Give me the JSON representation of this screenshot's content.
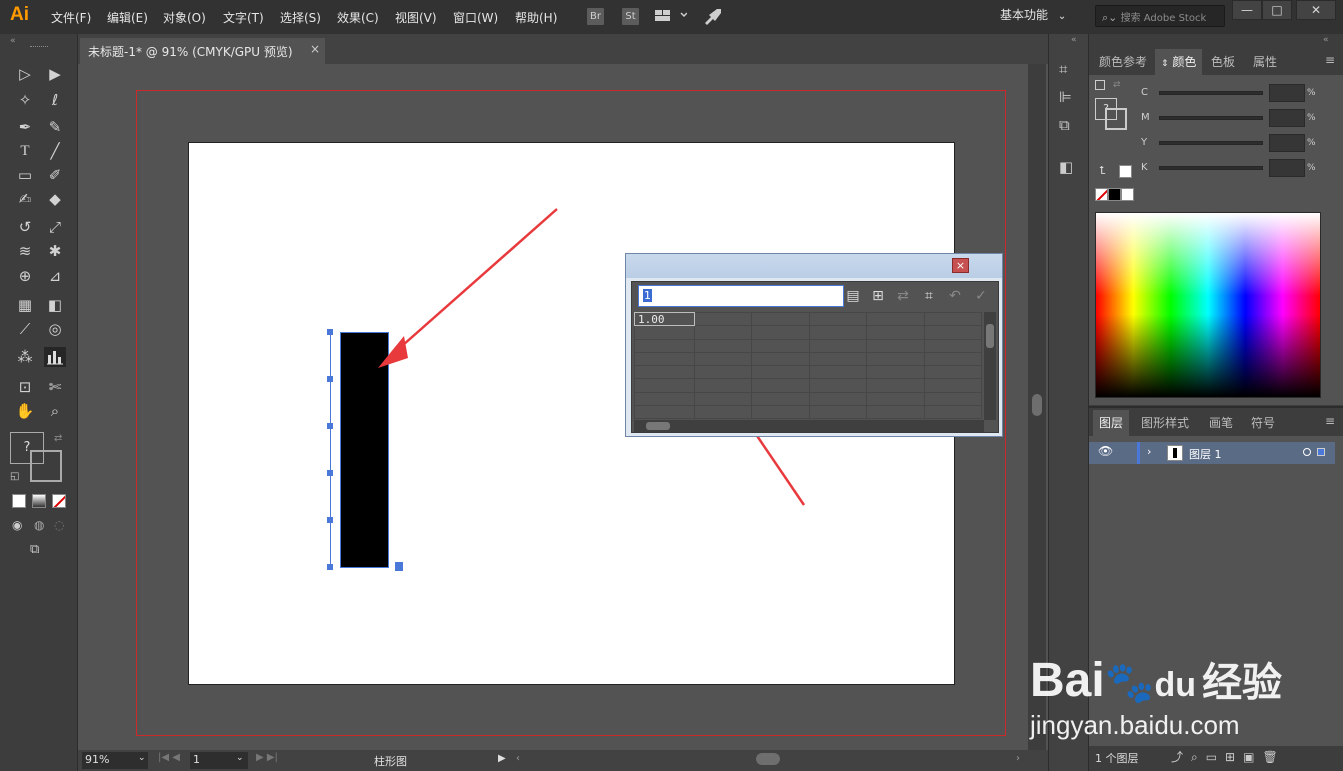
{
  "app": {
    "logo": "Ai"
  },
  "menu": [
    "文件(F)",
    "编辑(E)",
    "对象(O)",
    "文字(T)",
    "选择(S)",
    "效果(C)",
    "视图(V)",
    "窗口(W)",
    "帮助(H)"
  ],
  "menu_tools": {
    "br": "Br",
    "st": "St"
  },
  "workspace": {
    "label": "基本功能"
  },
  "search": {
    "placeholder": "搜索 Adobe Stock"
  },
  "window_controls": {
    "minimize": "—",
    "maximize": "□",
    "close": "✕"
  },
  "document_tab": {
    "title": "未标题-1* @ 91% (CMYK/GPU 预览)",
    "close": "×"
  },
  "graph_data_dialog": {
    "input_value": "1",
    "close": "×",
    "cells": [
      [
        "1.00",
        "",
        "",
        "",
        "",
        ""
      ]
    ]
  },
  "chart_data": {
    "type": "bar",
    "categories": [
      ""
    ],
    "values": [
      1.0
    ]
  },
  "toolbar_extras": {
    "unknown_fill": "?"
  },
  "color_panel": {
    "tabs": [
      "颜色参考",
      "颜色",
      "色板",
      "属性"
    ],
    "active_tab": "颜色",
    "channels": [
      "C",
      "M",
      "Y",
      "K"
    ],
    "percent": "%",
    "swatch_unknown": "?"
  },
  "layers_panel": {
    "tabs": [
      "图层",
      "图形样式",
      "画笔",
      "符号"
    ],
    "layer_name": "图层 1",
    "footer_count": "1 个图层"
  },
  "status_bar": {
    "zoom": "91%",
    "page": "1",
    "tool_name": "柱形图"
  },
  "watermark": {
    "brand_left": "Bai",
    "brand_mid": "du",
    "brand_right": "经验",
    "url": "jingyan.baidu.com"
  },
  "colors": {
    "accent": "#4a78d8",
    "bleed": "#cc2a2a",
    "annotation_arrow": "#e8393c",
    "logo": "#ff9a00"
  }
}
